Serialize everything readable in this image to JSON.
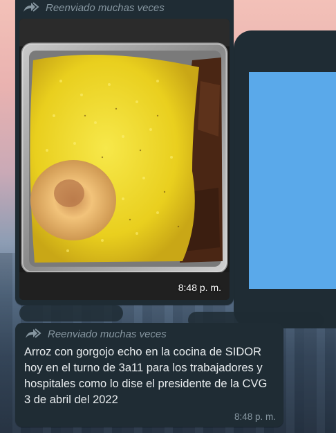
{
  "chat": {
    "messages": [
      {
        "type": "image",
        "forwarded_label": "Reenviado muchas veces",
        "time": "8:48 p. m."
      },
      {
        "type": "text",
        "forwarded_label": "Reenviado muchas veces",
        "text": "Arroz con gorgojo echo en la cocina de SIDOR hoy en el turno de 3a11 para los trabajadores y hospitales  como lo dise el presidente de la CVG 3 de abril del 2022",
        "time": "8:48 p. m."
      }
    ]
  },
  "colors": {
    "bubble": "#1f2c34",
    "meta_text": "#8696a0",
    "preview_screen": "#5aa9ea"
  },
  "icons": [
    "forwarded-arrow-icon"
  ]
}
